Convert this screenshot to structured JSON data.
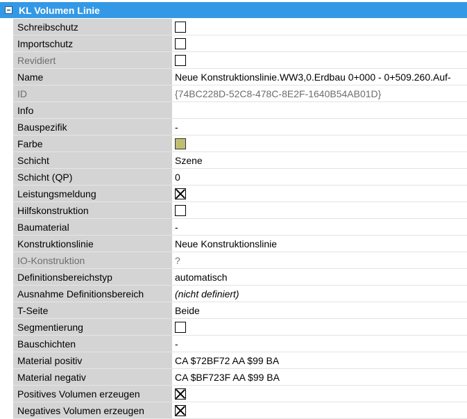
{
  "header": {
    "title": "KL Volumen Linie"
  },
  "rows": [
    {
      "label": "Schreibschutz",
      "type": "checkbox",
      "checked": false
    },
    {
      "label": "Importschutz",
      "type": "checkbox",
      "checked": false
    },
    {
      "label": "Revidiert",
      "type": "checkbox",
      "checked": false,
      "disabled": true
    },
    {
      "label": "Name",
      "type": "text",
      "value": "Neue Konstruktionslinie.WW3,0.Erdbau 0+000 - 0+509.260.Auf-"
    },
    {
      "label": "ID",
      "type": "text",
      "value": "{74BC228D-52C8-478C-8E2F-1640B54AB01D}",
      "disabled": true,
      "gray": true
    },
    {
      "label": "Info",
      "type": "text",
      "value": ""
    },
    {
      "label": "Bauspezifik",
      "type": "text",
      "value": "-"
    },
    {
      "label": "Farbe",
      "type": "color",
      "color": "#bfbf72"
    },
    {
      "label": "Schicht",
      "type": "text",
      "value": "Szene"
    },
    {
      "label": "Schicht (QP)",
      "type": "text",
      "value": "0"
    },
    {
      "label": "Leistungsmeldung",
      "type": "checkbox",
      "checked": true
    },
    {
      "label": "Hilfskonstruktion",
      "type": "checkbox",
      "checked": false
    },
    {
      "label": "Baumaterial",
      "type": "text",
      "value": "-"
    },
    {
      "label": "Konstruktionslinie",
      "type": "text",
      "value": "Neue Konstruktionslinie"
    },
    {
      "label": "IO-Konstruktion",
      "type": "text",
      "value": "?",
      "disabled": true,
      "gray": true
    },
    {
      "label": "Definitionsbereichstyp",
      "type": "text",
      "value": "automatisch"
    },
    {
      "label": "Ausnahme Definitionsbereich",
      "type": "text",
      "value": "(nicht definiert)",
      "italic": true
    },
    {
      "label": "T-Seite",
      "type": "text",
      "value": "Beide"
    },
    {
      "label": "Segmentierung",
      "type": "checkbox",
      "checked": false
    },
    {
      "label": "Bauschichten",
      "type": "text",
      "value": "-"
    },
    {
      "label": "Material positiv",
      "type": "text",
      "value": "CA $72BF72 AA $99 BA"
    },
    {
      "label": "Material negativ",
      "type": "text",
      "value": "CA $BF723F AA $99 BA"
    },
    {
      "label": "Positives Volumen erzeugen",
      "type": "checkbox",
      "checked": true
    },
    {
      "label": "Negatives Volumen erzeugen",
      "type": "checkbox",
      "checked": true
    }
  ]
}
